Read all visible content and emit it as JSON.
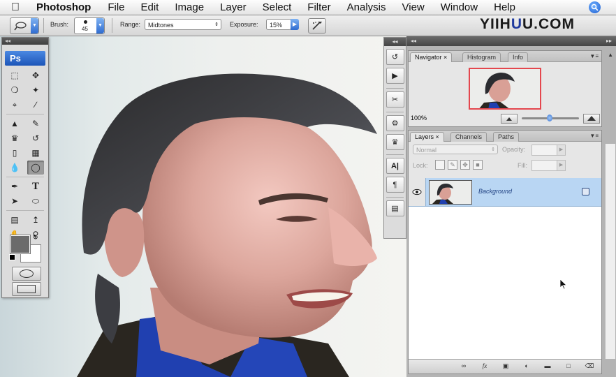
{
  "menubar": {
    "app": "Photoshop",
    "items": [
      "File",
      "Edit",
      "Image",
      "Layer",
      "Select",
      "Filter",
      "Analysis",
      "View",
      "Window",
      "Help"
    ]
  },
  "options": {
    "brush_label": "Brush:",
    "brush_size": "45",
    "range_label": "Range:",
    "range_value": "Midtones",
    "exposure_label": "Exposure:",
    "exposure_value": "15%"
  },
  "watermark": {
    "a": "YIIH",
    "b": "U",
    "c": "U.COM"
  },
  "toolbox": {
    "badge": "Ps"
  },
  "navigator": {
    "tabs": [
      "Navigator",
      "Histogram",
      "Info"
    ],
    "zoom": "100%"
  },
  "layers": {
    "tabs": [
      "Layers",
      "Channels",
      "Paths"
    ],
    "blend_mode": "Normal",
    "opacity_label": "Opacity:",
    "lock_label": "Lock:",
    "fill_label": "Fill:",
    "layer_name": "Background"
  },
  "colors": {
    "accent": "#1d55b8",
    "selection": "#b9d6f3",
    "nav_view": "#e4474e"
  }
}
